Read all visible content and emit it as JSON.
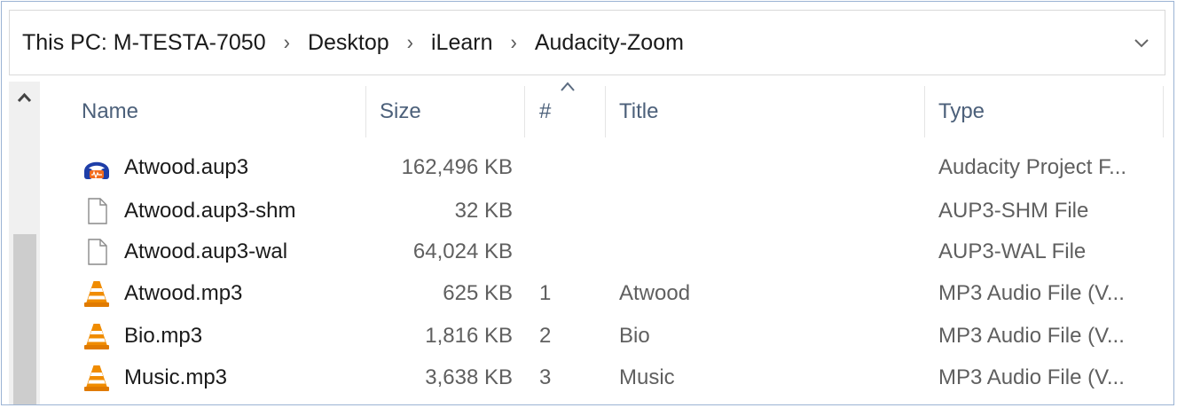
{
  "address_bar": {
    "crumbs": [
      "This PC: M-TESTA-7050",
      "Desktop",
      "iLearn",
      "Audacity-Zoom"
    ],
    "separator": "›",
    "dropdown_icon": "chevron-down-icon"
  },
  "columns": {
    "name": "Name",
    "size": "Size",
    "number": "#",
    "title": "Title",
    "type": "Type",
    "sorted_by": "#"
  },
  "files": [
    {
      "icon": "audacity-icon",
      "name": "Atwood.aup3",
      "size": "162,496 KB",
      "number": "",
      "title": "",
      "type": "Audacity Project F..."
    },
    {
      "icon": "blank-file-icon",
      "name": "Atwood.aup3-shm",
      "size": "32 KB",
      "number": "",
      "title": "",
      "type": "AUP3-SHM File"
    },
    {
      "icon": "blank-file-icon",
      "name": "Atwood.aup3-wal",
      "size": "64,024 KB",
      "number": "",
      "title": "",
      "type": "AUP3-WAL File"
    },
    {
      "icon": "vlc-cone-icon",
      "name": "Atwood.mp3",
      "size": "625 KB",
      "number": "1",
      "title": "Atwood",
      "type": "MP3 Audio File (V..."
    },
    {
      "icon": "vlc-cone-icon",
      "name": "Bio.mp3",
      "size": "1,816 KB",
      "number": "2",
      "title": "Bio",
      "type": "MP3 Audio File (V..."
    },
    {
      "icon": "vlc-cone-icon",
      "name": "Music.mp3",
      "size": "3,638 KB",
      "number": "3",
      "title": "Music",
      "type": "MP3 Audio File (V..."
    }
  ],
  "colors": {
    "header_text": "#4c607a",
    "vlc_orange": "#f08c00",
    "audacity_blue": "#1e3ea8"
  }
}
